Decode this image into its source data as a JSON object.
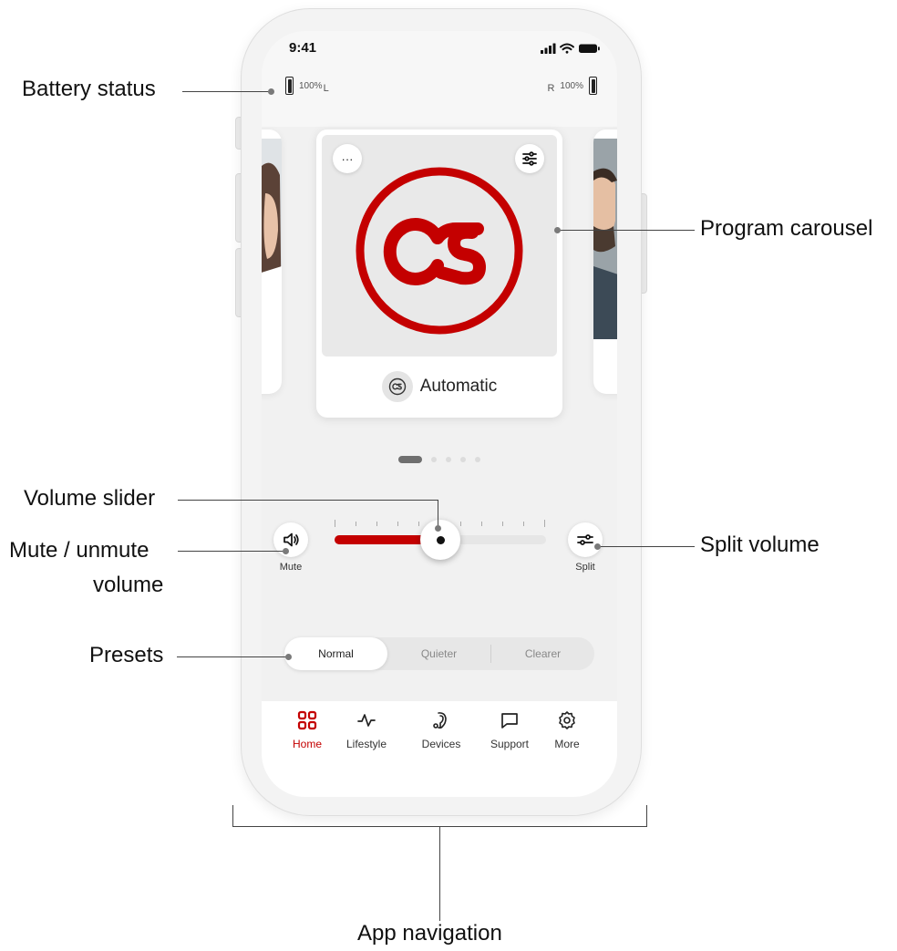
{
  "status_bar": {
    "time": "9:41"
  },
  "battery": {
    "left": {
      "level": "100%",
      "side": "L"
    },
    "right": {
      "level": "100%",
      "side": "R"
    }
  },
  "program": {
    "name": "Automatic",
    "more_label": "···",
    "active_index": 0,
    "count": 5,
    "logo_color": "#c40000"
  },
  "volume": {
    "mute_label": "Mute",
    "split_label": "Split",
    "level_fraction": 0.5
  },
  "presets": {
    "items": [
      "Normal",
      "Quieter",
      "Clearer"
    ],
    "selected": "Normal"
  },
  "nav": {
    "items": [
      {
        "label": "Home",
        "icon": "grid-icon",
        "active": true
      },
      {
        "label": "Lifestyle",
        "icon": "activity-icon",
        "active": false
      },
      {
        "label": "Devices",
        "icon": "hearing-aid-icon",
        "active": false
      },
      {
        "label": "Support",
        "icon": "chat-bubble-icon",
        "active": false
      },
      {
        "label": "More",
        "icon": "gear-icon",
        "active": false
      }
    ]
  },
  "annotations": {
    "battery_status": "Battery status",
    "program_carousel": "Program carousel",
    "volume_slider": "Volume slider",
    "mute_unmute_line1": "Mute / unmute",
    "mute_unmute_line2": "volume",
    "split_volume": "Split volume",
    "presets": "Presets",
    "app_navigation": "App navigation"
  },
  "colors": {
    "accent": "#c40000",
    "nav_active": "#c40000"
  }
}
